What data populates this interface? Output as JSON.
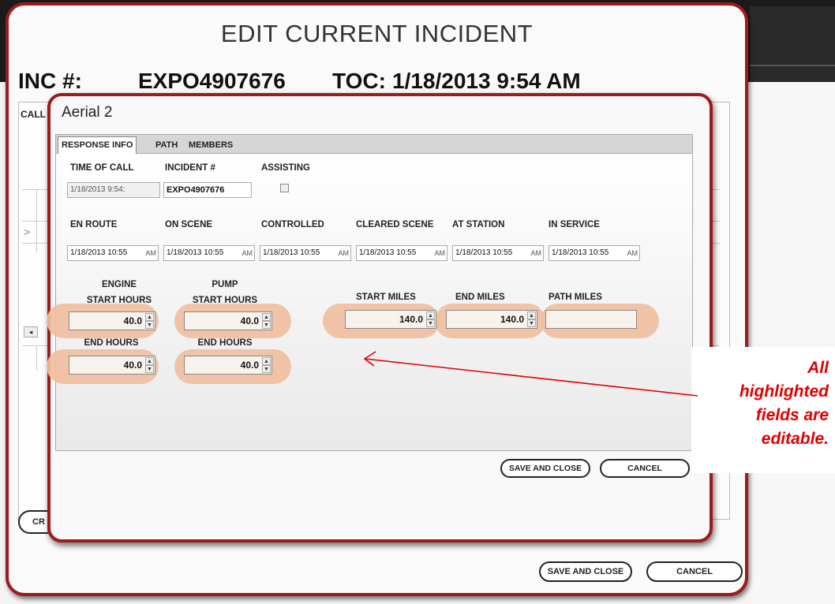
{
  "outer_modal": {
    "title": "EDIT CURRENT INCIDENT",
    "inc_label": "INC #:",
    "inc_value": "EXPO4907676",
    "toc_label": "TOC:",
    "toc_value": "1/18/2013 9:54 AM",
    "calls_tab": "CALL",
    "create_button": "CR",
    "save_button": "SAVE AND CLOSE",
    "cancel_button": "CANCEL"
  },
  "inner_modal": {
    "title": "Aerial 2",
    "tabs": [
      {
        "label": "RESPONSE INFO",
        "active": true
      },
      {
        "label": "PATH",
        "active": false
      },
      {
        "label": "MEMBERS",
        "active": false
      }
    ],
    "time_of_call_label": "TIME OF CALL",
    "time_of_call_value": "1/18/2013 9:54:",
    "incident_label": "INCIDENT #",
    "incident_value": "EXPO4907676",
    "assisting_label": "ASSISTING",
    "assisting_checked": false,
    "timestamps": [
      {
        "label": "EN ROUTE",
        "value": "1/18/2013 10:55",
        "suffix": "AM"
      },
      {
        "label": "ON SCENE",
        "value": "1/18/2013 10:55",
        "suffix": "AM"
      },
      {
        "label": "CONTROLLED",
        "value": "1/18/2013 10:55",
        "suffix": "AM"
      },
      {
        "label": "CLEARED SCENE",
        "value": "1/18/2013 10:55",
        "suffix": "AM"
      },
      {
        "label": "AT STATION",
        "value": "1/18/2013 10:55",
        "suffix": "AM"
      },
      {
        "label": "IN SERVICE",
        "value": "1/18/2013 10:55",
        "suffix": "AM"
      }
    ],
    "engine_label_1": "ENGINE",
    "engine_label_2": "START HOURS",
    "engine_start_hours": "40.0",
    "engine_end_label": "END HOURS",
    "engine_end_hours": "40.0",
    "pump_label_1": "PUMP",
    "pump_label_2": "START HOURS",
    "pump_start_hours": "40.0",
    "pump_end_label": "END HOURS",
    "pump_end_hours": "40.0",
    "start_miles_label": "START MILES",
    "start_miles": "140.0",
    "end_miles_label": "END MILES",
    "end_miles": "140.0",
    "path_miles_label": "PATH MILES",
    "path_miles": "",
    "save_button": "SAVE AND CLOSE",
    "cancel_button": "CANCEL"
  },
  "annotation": {
    "lines": [
      "All",
      "highlighted",
      "fields are",
      "editable."
    ],
    "color": "#e00000"
  },
  "colors": {
    "modal_border": "#9e1b1b",
    "highlight": "#f0bfa0"
  }
}
